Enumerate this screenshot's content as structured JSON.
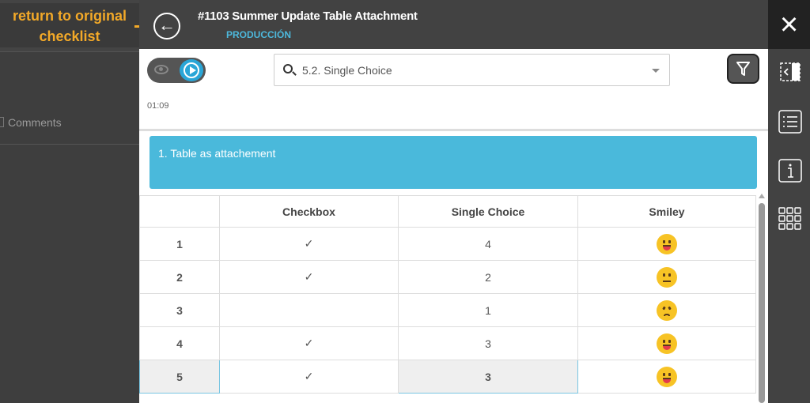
{
  "annotation": {
    "line1": "return to original",
    "line2": "checklist"
  },
  "left_panel": {
    "comments_label": "Comments"
  },
  "header": {
    "title": "#1103 Summer Update Table Attachment",
    "subtitle": "PRODUCCIÓN",
    "back_icon": "arrow-left-circle"
  },
  "close_icon": "×",
  "toolbar": {
    "timer": "01:09",
    "search_value": "5.2. Single Choice",
    "filter_icon": "filter"
  },
  "question": {
    "label": "1.  Table as attachement"
  },
  "table": {
    "headers": [
      "",
      "Checkbox",
      "Single Choice",
      "Smiley"
    ],
    "rows": [
      {
        "no": "1",
        "checkbox": "✓",
        "choice": "4",
        "smiley": "happy"
      },
      {
        "no": "2",
        "checkbox": "✓",
        "choice": "2",
        "smiley": "neutral"
      },
      {
        "no": "3",
        "checkbox": "",
        "choice": "1",
        "smiley": "angry"
      },
      {
        "no": "4",
        "checkbox": "✓",
        "choice": "3",
        "smiley": "happy"
      },
      {
        "no": "5",
        "checkbox": "✓",
        "choice": "3",
        "smiley": "happy"
      }
    ]
  },
  "colors": {
    "accent": "#4ab9db",
    "annotation": "#f3a928",
    "subtitle": "#4db8dc"
  }
}
